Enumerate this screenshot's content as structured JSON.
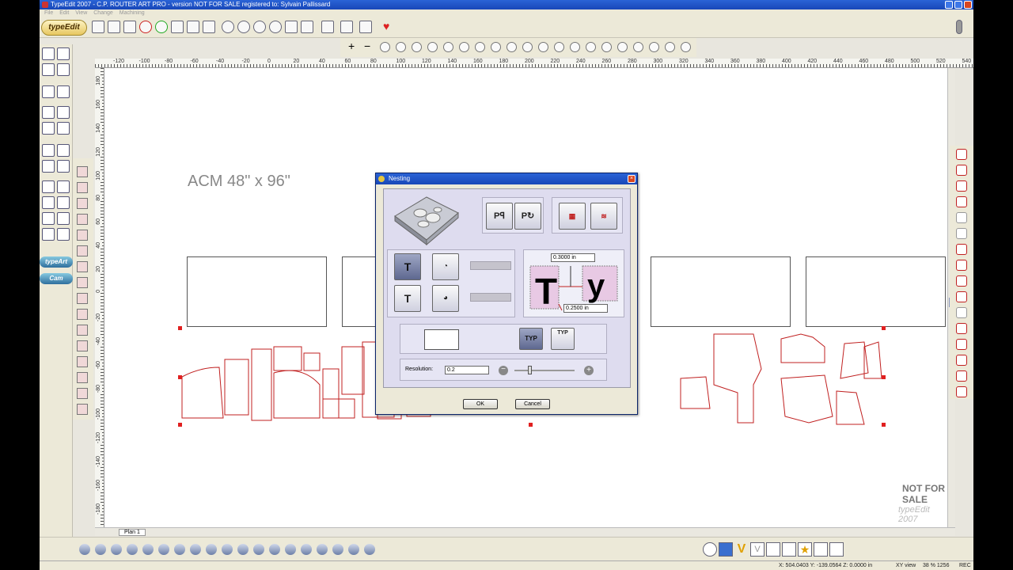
{
  "window": {
    "title": "TypeEdit 2007 - C.P. ROUTER ART PRO - version NOT FOR SALE registered to: Sylvain Pallissard"
  },
  "menu": [
    "File",
    "Edit",
    "View",
    "Change",
    "Machining"
  ],
  "logo": "typeEdit",
  "left_pills": {
    "typeart": "typeArt",
    "cam": "Cam"
  },
  "ruler_top": [
    "-120",
    "-100",
    "-80",
    "-60",
    "-40",
    "-20",
    "0",
    "20",
    "40",
    "60",
    "80",
    "100",
    "120",
    "140",
    "160",
    "180",
    "200",
    "220",
    "240",
    "260",
    "280",
    "300",
    "320",
    "340",
    "360",
    "380",
    "400",
    "420",
    "440",
    "460",
    "480",
    "500",
    "520",
    "540"
  ],
  "ruler_left": [
    "180",
    "160",
    "140",
    "120",
    "100",
    "80",
    "60",
    "40",
    "20",
    "0",
    "-20",
    "-40",
    "-60",
    "-80",
    "-100",
    "-120",
    "-140",
    "-160",
    "-180"
  ],
  "canvas": {
    "sheet_label": "ACM 48\" x 96\"",
    "not_for_sale": "NOT FOR SALE",
    "brand_watermark": "typeEdit 2007"
  },
  "plan_tab": "Plan 1",
  "dialog": {
    "title": "Nesting",
    "dim_top": "0.3000 in",
    "dim_bottom": "0.2500 in",
    "typ_horizontal": "TYP",
    "typ_vertical": "TYP",
    "resolution_label": "Resolution:",
    "resolution_value": "0.2",
    "slider_level": 0.25,
    "ok": "OK",
    "cancel": "Cancel"
  },
  "status": {
    "coords": "X: 504.0403   Y: -139.0564   Z: 0.0000 in",
    "view": "XY view",
    "zoom": "38 % 1256",
    "rec": "REC"
  },
  "colors": {
    "accent": "#2a63d6",
    "cut_paths": "#c02020",
    "dialog_bg": "#ece9d8"
  }
}
